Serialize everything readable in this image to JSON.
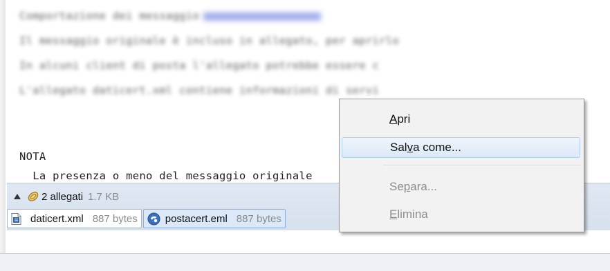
{
  "message": {
    "blurred_lines": [
      "Comportazione dei messaggio",
      "Il messaggio originale è incluso in allegato, per aprirlo",
      "In alcuni client di posta l'allegato potrebbe essere c",
      "L'allegato daticert.xml contiene informazioni di servi"
    ],
    "nota_heading": "NOTA",
    "nota_line": "  La presenza o meno del messaggio originale"
  },
  "attachments": {
    "count_label": "2 allegati",
    "total_size": "1.7 KB",
    "items": [
      {
        "name": "daticert.xml",
        "size": "887 bytes",
        "icon": "xml-file-icon"
      },
      {
        "name": "postacert.eml",
        "size": "887 bytes",
        "icon": "eml-file-icon"
      }
    ]
  },
  "context_menu": {
    "items": [
      {
        "pre": "",
        "key": "A",
        "post": "pri",
        "state": "normal"
      },
      {
        "pre": "Sal",
        "key": "v",
        "post": "a come...",
        "state": "hovered"
      },
      {
        "pre": "Se",
        "key": "p",
        "post": "ara...",
        "state": "disabled"
      },
      {
        "pre": "",
        "key": "E",
        "post": "limina",
        "state": "disabled"
      }
    ]
  },
  "colors": {
    "attachment_bar": "#d6e1ee",
    "menu_hover": "#dbe9f7",
    "link_blur": "#8f9ee8"
  }
}
